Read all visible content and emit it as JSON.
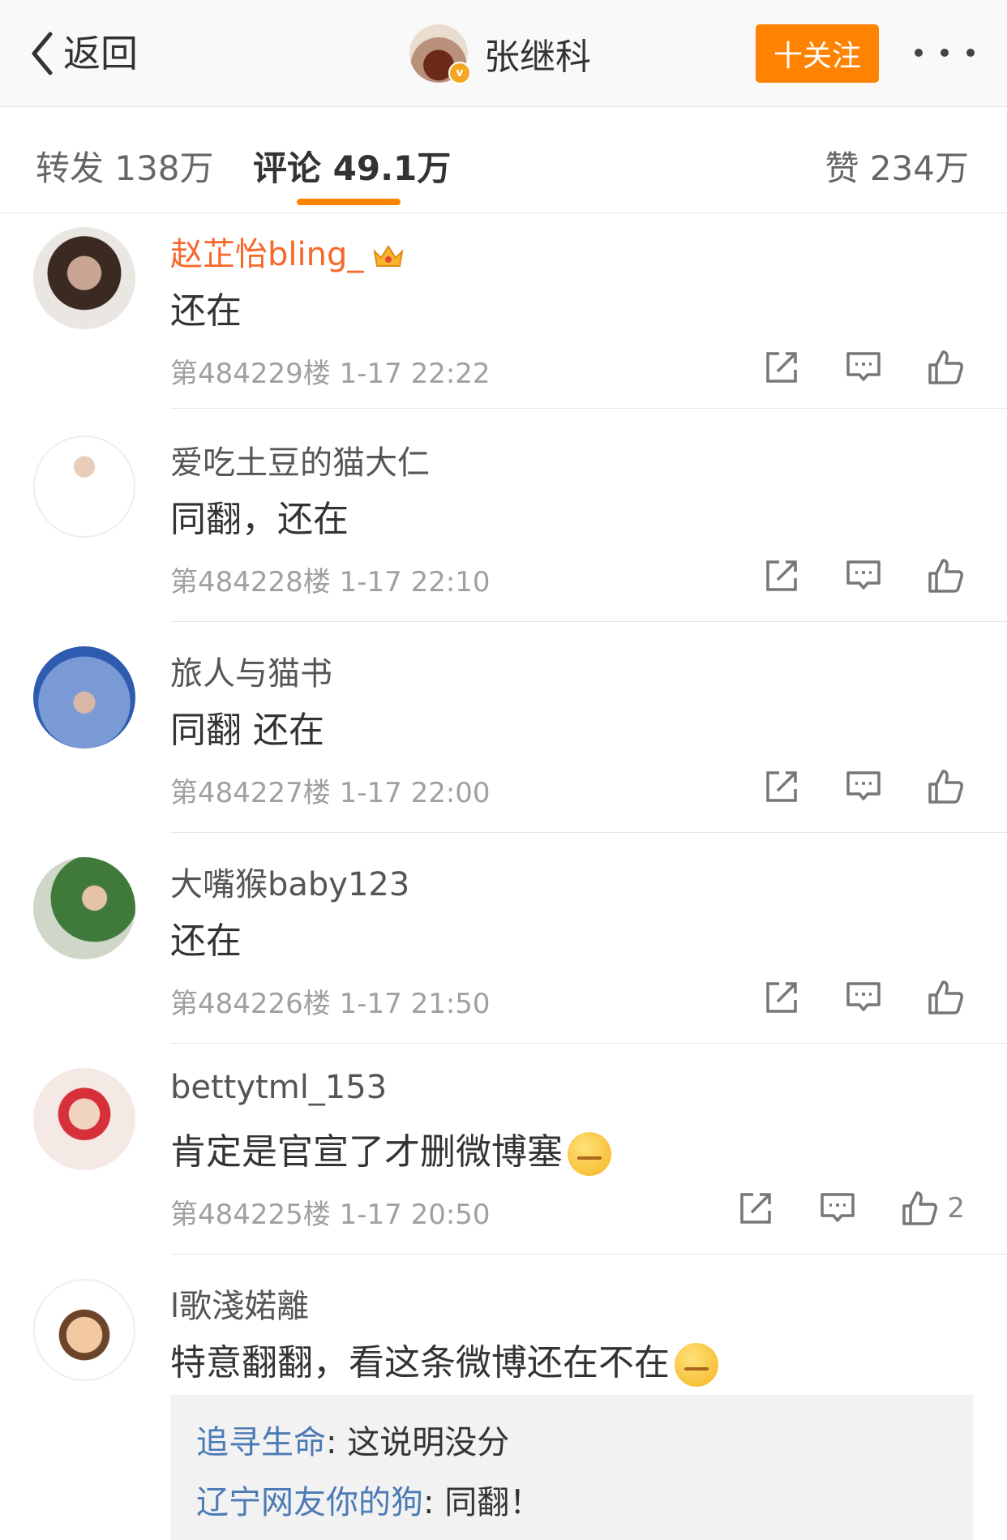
{
  "nav": {
    "back_label": "返回",
    "user_name": "张继科",
    "verified_badge": "v",
    "follow_label": "十关注"
  },
  "tabs": [
    {
      "label": "转发 138万",
      "active": false
    },
    {
      "label": "评论 49.1万",
      "active": true
    },
    {
      "label": "赞 234万",
      "active": false
    }
  ],
  "comments": [
    {
      "user": "赵芷怡bling_",
      "vip": true,
      "text": "还在",
      "meta": "第484229楼 1-17 22:22",
      "likes": ""
    },
    {
      "user": "爱吃土豆的猫大仁",
      "vip": false,
      "text": "同翻，还在",
      "meta": "第484228楼 1-17 22:10",
      "likes": ""
    },
    {
      "user": "旅人与猫书",
      "vip": false,
      "text": "同翻  还在",
      "meta": "第484227楼 1-17 22:00",
      "likes": ""
    },
    {
      "user": "大嘴猴baby123",
      "vip": false,
      "text": "还在",
      "meta": "第484226楼 1-17 21:50",
      "likes": ""
    },
    {
      "user": "bettytml_153",
      "vip": false,
      "text": "肯定是官宣了才删微博塞",
      "meta": "第484225楼 1-17 20:50",
      "likes": "2"
    },
    {
      "user": "l歌淺婼離",
      "vip": false,
      "text": "特意翻翻，看这条微博还在不在",
      "meta": "",
      "likes": ""
    }
  ],
  "replies": [
    {
      "user": "追寻生命",
      "text": ": 这说明没分"
    },
    {
      "user": "辽宁网友你的狗",
      "text": ": 同翻！"
    }
  ],
  "colors": {
    "accent": "#ff8200",
    "vip_name": "#f7672b",
    "reply_name": "#4b7ab5",
    "meta_text": "#a0a0a0"
  },
  "icons": [
    "back-chevron-icon",
    "more-dots-icon",
    "repost-icon",
    "comment-icon",
    "like-icon",
    "crown-icon",
    "sweat-emoji-icon",
    "laugh-cry-emoji-icon"
  ]
}
